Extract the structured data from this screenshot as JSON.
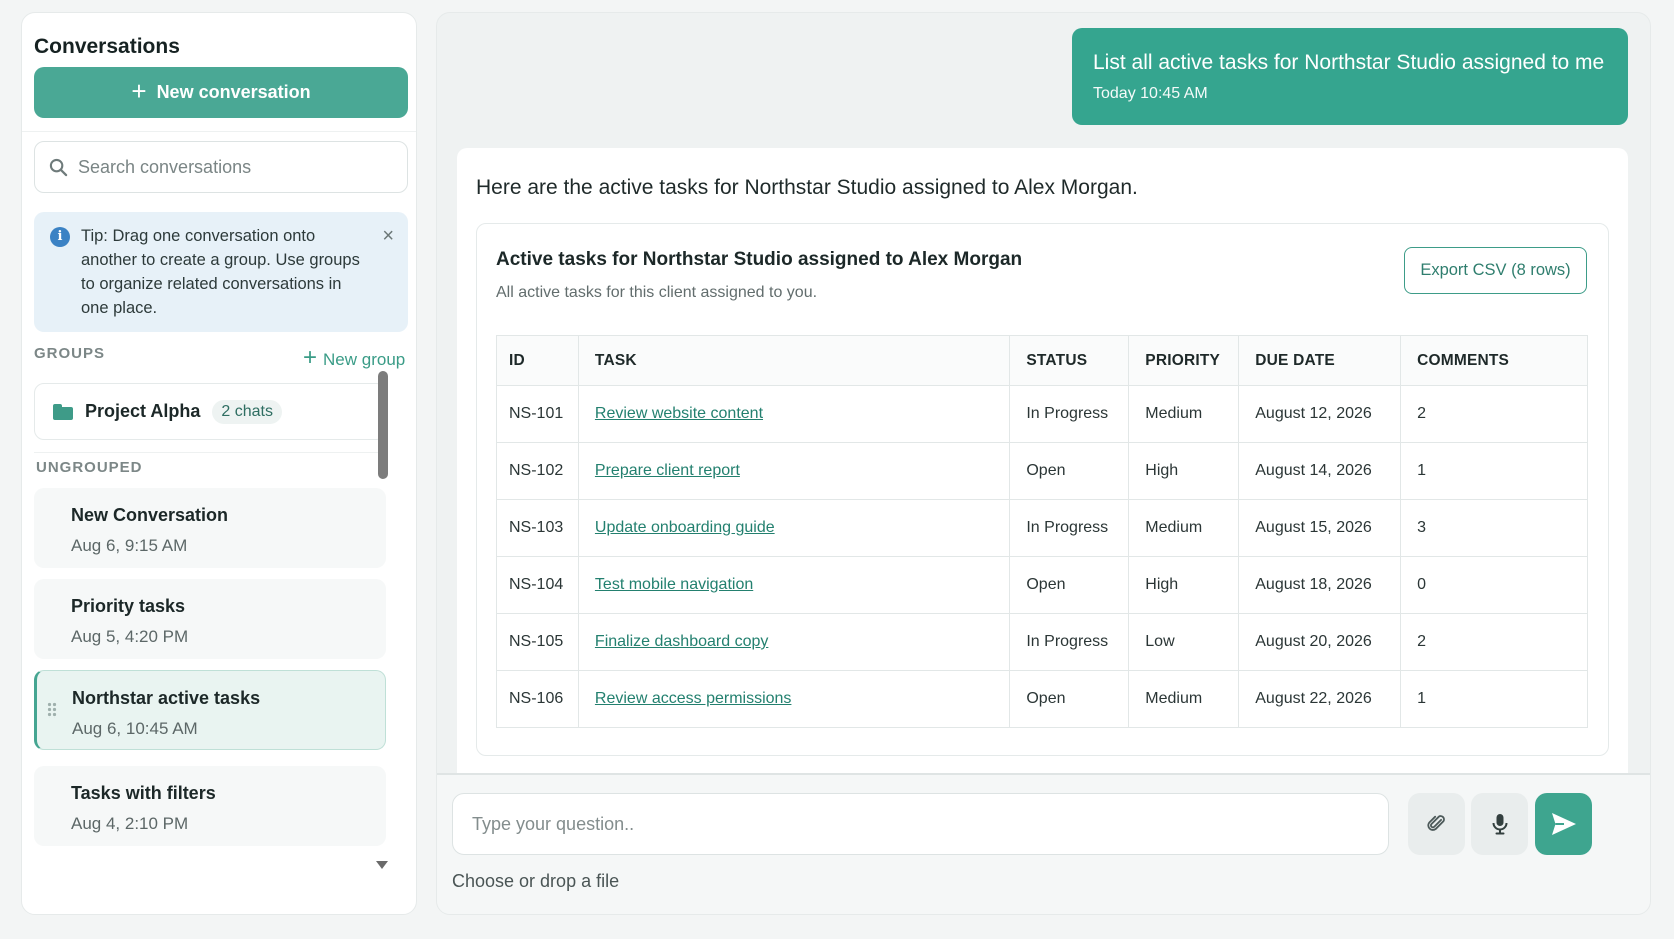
{
  "sidebar": {
    "title": "Conversations",
    "new_conversation_label": "New conversation",
    "search_placeholder": "Search conversations",
    "tip": "Tip: Drag one conversation onto another to create a group. Use groups to organize related conversations in one place.",
    "groups_label": "GROUPS",
    "new_group_label": "New group",
    "groups": [
      {
        "name": "Project Alpha",
        "count": "2 chats"
      }
    ],
    "ungrouped_label": "UNGROUPED",
    "conversations": [
      {
        "title": "New Conversation",
        "date": "Aug 6, 9:15 AM"
      },
      {
        "title": "Priority tasks",
        "date": "Aug 5, 4:20 PM"
      },
      {
        "title": "Northstar active tasks",
        "date": "Aug 6, 10:45 AM",
        "active": true
      },
      {
        "title": "Tasks with filters",
        "date": "Aug 4, 2:10 PM"
      }
    ]
  },
  "chat": {
    "user_message": "List all active tasks for Northstar Studio assigned to me",
    "user_time": "Today 10:45 AM",
    "assistant_intro": "Here are the active tasks for Northstar Studio assigned to Alex Morgan.",
    "card_title": "Active tasks for Northstar Studio assigned to Alex Morgan",
    "card_subtitle": "All active tasks for this client assigned to you.",
    "export_label": "Export CSV (8 rows)",
    "columns": [
      "ID",
      "TASK",
      "STATUS",
      "PRIORITY",
      "DUE DATE",
      "COMMENTS"
    ],
    "rows": [
      {
        "id": "NS-101",
        "task": "Review website content",
        "status": "In Progress",
        "priority": "Medium",
        "due": "August 12, 2026",
        "comments": "2"
      },
      {
        "id": "NS-102",
        "task": "Prepare client report",
        "status": "Open",
        "priority": "High",
        "due": "August 14, 2026",
        "comments": "1"
      },
      {
        "id": "NS-103",
        "task": "Update onboarding guide",
        "status": "In Progress",
        "priority": "Medium",
        "due": "August 15, 2026",
        "comments": "3"
      },
      {
        "id": "NS-104",
        "task": "Test mobile navigation",
        "status": "Open",
        "priority": "High",
        "due": "August 18, 2026",
        "comments": "0"
      },
      {
        "id": "NS-105",
        "task": "Finalize dashboard copy",
        "status": "In Progress",
        "priority": "Low",
        "due": "August 20, 2026",
        "comments": "2"
      },
      {
        "id": "NS-106",
        "task": "Review access permissions",
        "status": "Open",
        "priority": "Medium",
        "due": "August 22, 2026",
        "comments": "1"
      }
    ]
  },
  "composer": {
    "placeholder": "Type your question..",
    "file_label": "Choose or drop a file"
  },
  "colors": {
    "accent": "#3ea58f",
    "link": "#23806f",
    "tip_bg": "#e7f1f8"
  }
}
